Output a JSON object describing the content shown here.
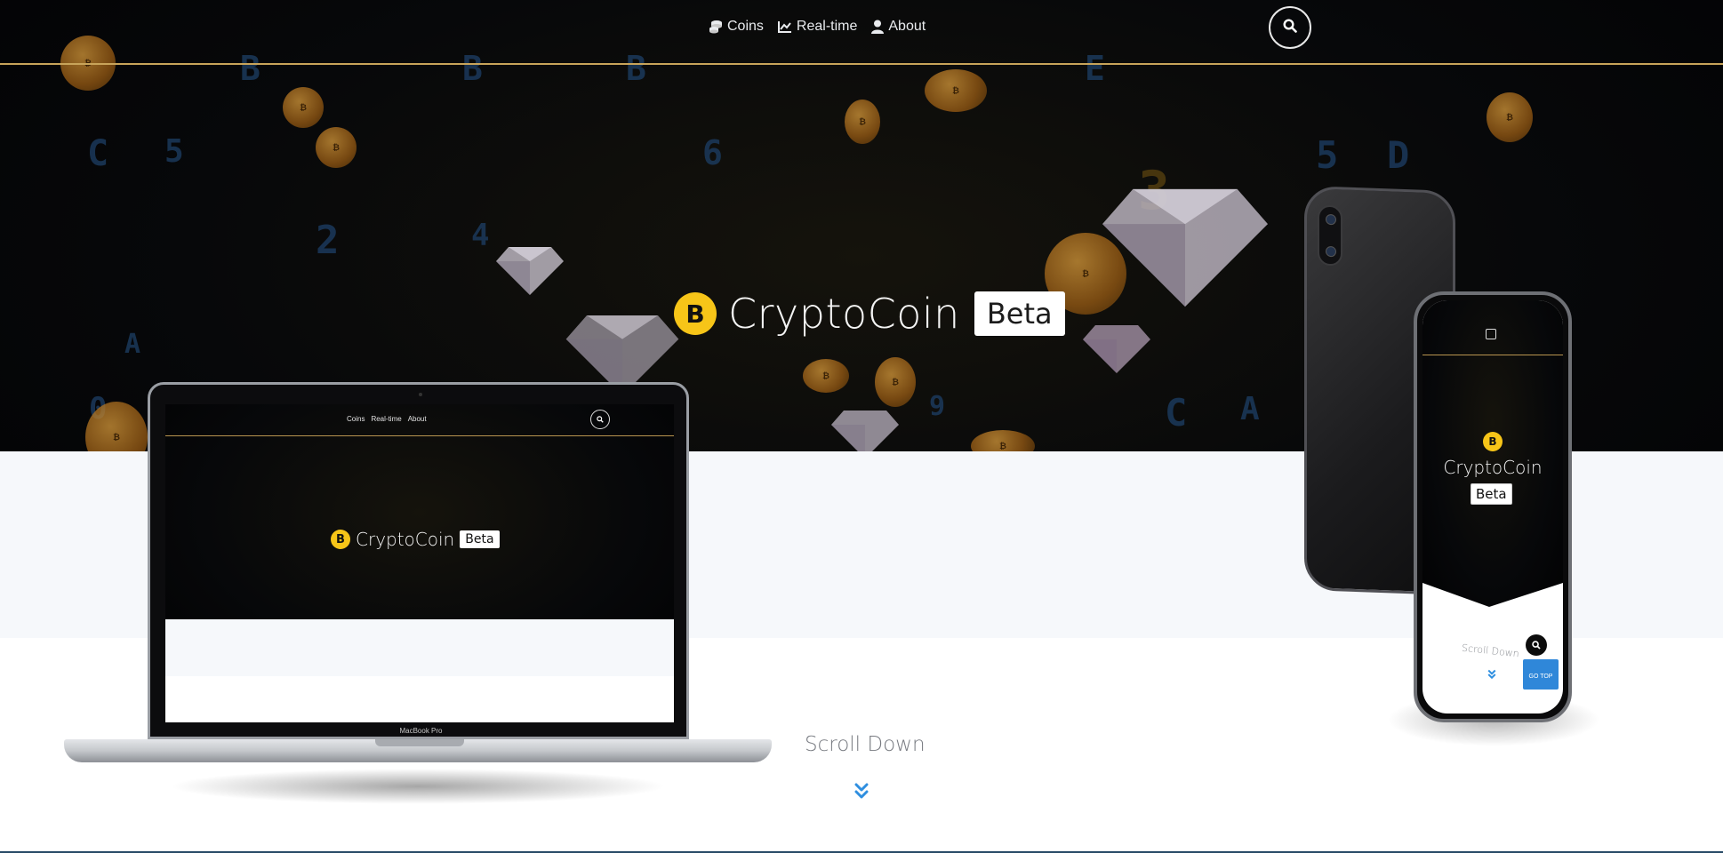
{
  "nav": {
    "links": [
      {
        "label": "Coins",
        "icon": "coins-icon"
      },
      {
        "label": "Real-time",
        "icon": "line-chart-icon"
      },
      {
        "label": "About",
        "icon": "user-icon"
      }
    ],
    "search_icon": "search-icon"
  },
  "hero": {
    "brand_title": "CryptoCoin",
    "badge": "Beta",
    "coin_symbol": "B",
    "scroll_label": "Scroll Down"
  },
  "laptop_mockup": {
    "nav_links": [
      "Coins",
      "Real-time",
      "About"
    ],
    "brand_title": "CryptoCoin",
    "badge": "Beta",
    "model_label": "MacBook Pro"
  },
  "phone_mockup": {
    "brand_title": "CryptoCoin",
    "badge": "Beta",
    "scroll_label": "Scroll Down",
    "go_top_label": "GO TOP"
  },
  "colors": {
    "accent_gold": "#c8a45a",
    "coin_yellow": "#f7c518",
    "go_top_blue": "#2f87d9",
    "chevron_blue": "#2f8fe0"
  }
}
